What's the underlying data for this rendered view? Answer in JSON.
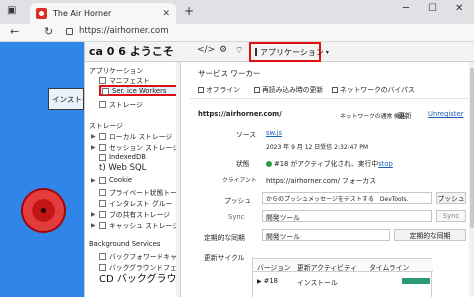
{
  "browser": {
    "tab_title": "The Air Horner",
    "tab_close": "✕",
    "new_tab": "+",
    "url": "https://airhorner.com",
    "window_controls": [
      "─",
      "☐",
      "✕"
    ]
  },
  "page": {
    "install_label": "インストール"
  },
  "devtools": {
    "title": "ca 0 6 ようこそ",
    "toolbar_icons": [
      "</>",
      "⚙",
      "⌔"
    ],
    "active_tab": "アプリケーション",
    "sidebar": {
      "app_section": "アプリケーション",
      "app_items": [
        "マニフェスト",
        "Ser. ice Workers",
        "ストレージ"
      ],
      "storage_section": "ストレージ",
      "storage_items": [
        "ローカル ストレージ",
        "セッション ストレージ",
        "IndexedDB",
        "t) Web SQL",
        "Cookie",
        "プライベート状態トークン",
        "インタレスト グルー",
        "ブの共有ストレージ",
        "キャッシュ ストレージ"
      ],
      "bg_section": "Background Services",
      "bg_items": [
        "バックフォワードキャッシュ",
        "バックグラウンドフェッチ"
      ],
      "bg_sync": "CD バックグラウンド同期"
    },
    "main": {
      "heading": "サービス ワーカー",
      "opt_offline": "オフライン",
      "opt_reload": "再読み込み時の更新",
      "opt_bypass": "ネットワークのバイパス",
      "origin": "https://airhorner.com/",
      "network_request": "ネットワークの通常 機能",
      "update": "更新",
      "unregister": "Unregister",
      "source_label": "ソース",
      "source_value": "sw.js",
      "received": "2023 年 9 月 12 日受信 2:32:47 PM",
      "status_label": "状態",
      "status_value": "#18 がアクティブ化され、実行中",
      "status_stop": "stop",
      "clients_label": "クライアント",
      "clients_value": "https://airhorner.com/ フォーカス",
      "push_label": "プッシュ",
      "push_value": "からのプッシュメッセージをテストする　DevTools.",
      "push_btn": "プッシュ",
      "sync_label": "Sync",
      "sync_value": "開発ツール",
      "sync_btn": "Sync",
      "periodic_label": "定期的な同期",
      "periodic_value": "開発ツール",
      "periodic_btn": "定期的な同期",
      "cycle_label": "更新サイクル",
      "table_headers": [
        "バージョン",
        "更新アクティビティ",
        "タイムライン"
      ],
      "table_row": [
        "#18",
        "インストール"
      ]
    }
  }
}
